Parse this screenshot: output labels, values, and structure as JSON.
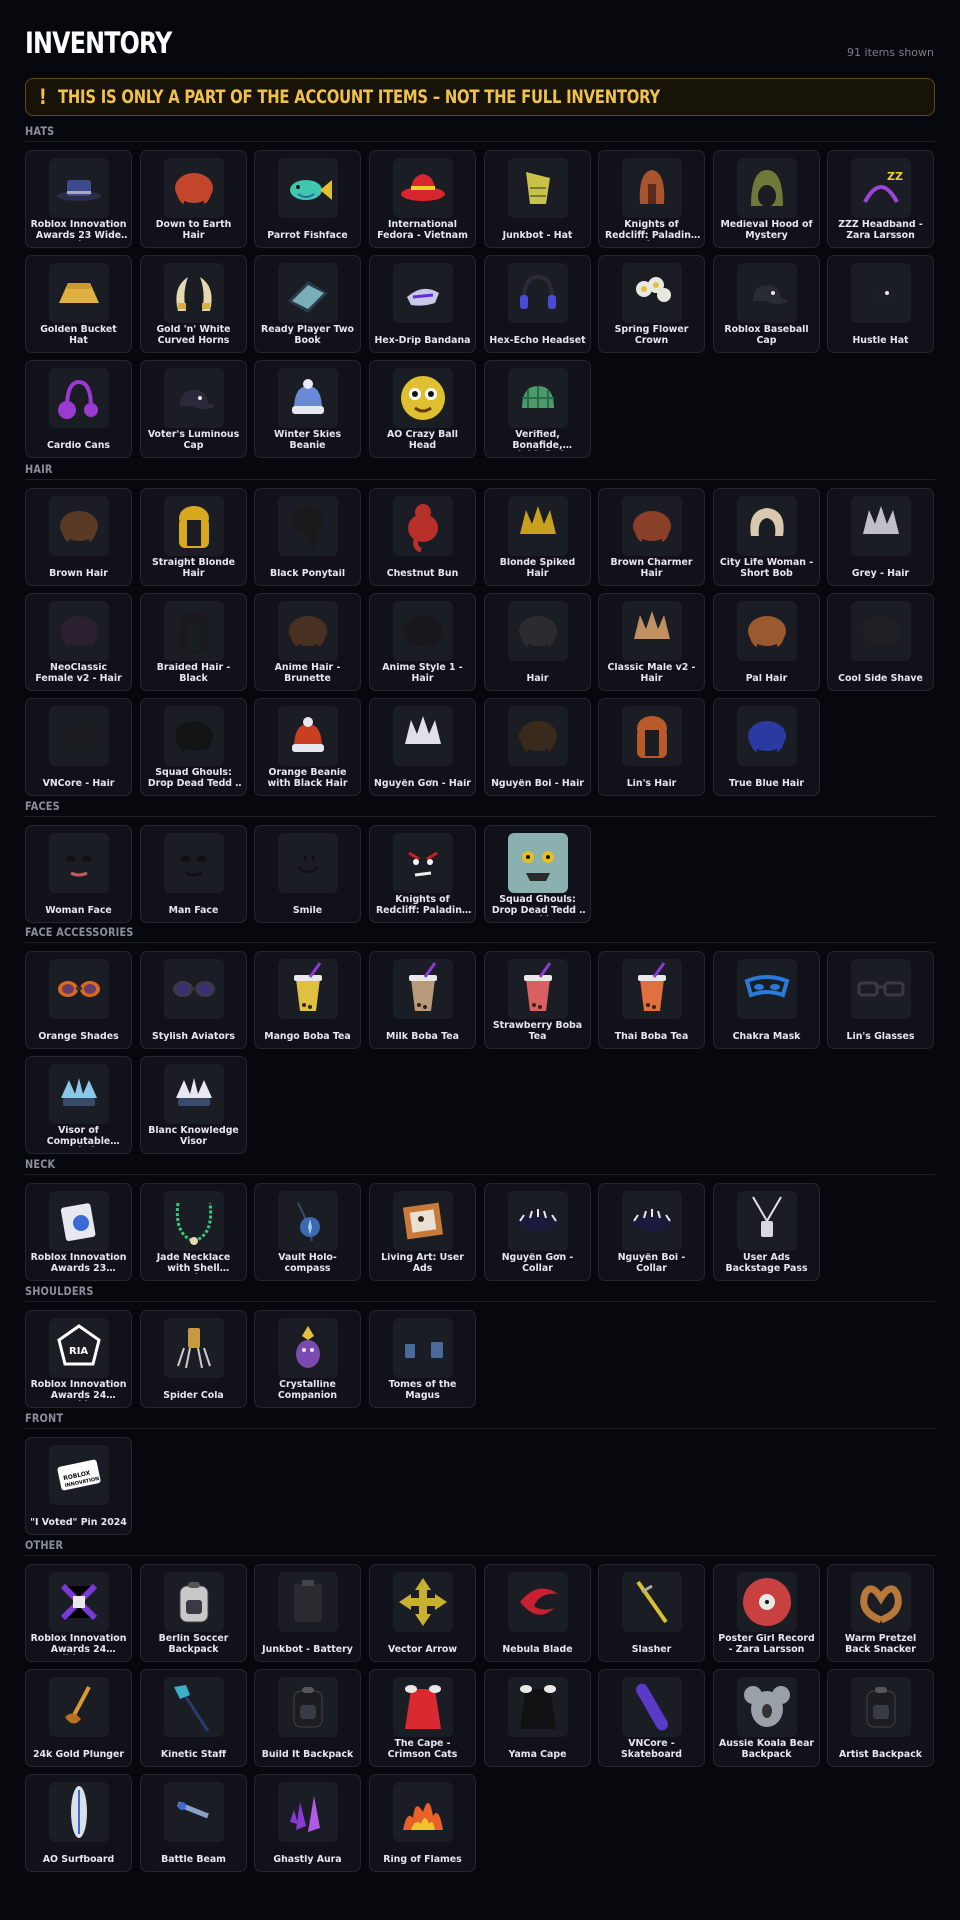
{
  "header": {
    "title": "INVENTORY",
    "count_text": "91 items shown"
  },
  "warning": {
    "icon": "!",
    "icon_name": "exclamation-icon",
    "text": "THIS IS ONLY A PART OF THE ACCOUNT ITEMS – NOT THE FULL INVENTORY",
    "color": "#f1c24a"
  },
  "sections": [
    {
      "label": "HATS",
      "items": [
        {
          "name": "Roblox Innovation Awards 23 Wide Bri…",
          "icon": "wide-brim-hat-icon",
          "color": "#3a4a8c"
        },
        {
          "name": "Down to Earth Hair",
          "icon": "hair-icon",
          "color": "#c2452c"
        },
        {
          "name": "Parrot Fishface",
          "icon": "fish-icon",
          "color": "#3ec8b0"
        },
        {
          "name": "International Fedora - Vietnam",
          "icon": "fedora-icon",
          "color": "#d8262e"
        },
        {
          "name": "Junkbot - Hat",
          "icon": "junk-hat-icon",
          "color": "#c8c24a"
        },
        {
          "name": "Knights of Redcliff: Paladin - Helmet",
          "icon": "helmet-icon",
          "color": "#a8542c"
        },
        {
          "name": "Medieval Hood of Mystery",
          "icon": "hood-icon",
          "color": "#6e7a3a"
        },
        {
          "name": "ZZZ Headband - Zara Larsson",
          "icon": "headband-icon",
          "color": "#9a44d8"
        },
        {
          "name": "Golden Bucket Hat",
          "icon": "bucket-hat-icon",
          "color": "#e0b040"
        },
        {
          "name": "Gold 'n' White Curved Horns",
          "icon": "horns-icon",
          "color": "#e3d8b0"
        },
        {
          "name": "Ready Player Two Book",
          "icon": "book-icon",
          "color": "#8ccad8"
        },
        {
          "name": "Hex-Drip Bandana",
          "icon": "bandana-icon",
          "color": "#c8c8e8"
        },
        {
          "name": "Hex-Echo Headset",
          "icon": "headset-icon",
          "color": "#4a4ad8"
        },
        {
          "name": "Spring Flower Crown",
          "icon": "flower-crown-icon",
          "color": "#e8e8e0"
        },
        {
          "name": "Roblox Baseball Cap",
          "icon": "cap-icon",
          "color": "#2a2c34"
        },
        {
          "name": "Hustle Hat",
          "icon": "cap-icon",
          "color": "#1c1e26"
        },
        {
          "name": "Cardio Cans",
          "icon": "earmuffs-icon",
          "color": "#9a3ad0"
        },
        {
          "name": "Voter's Luminous Cap",
          "icon": "cap-icon",
          "color": "#2a2a3a"
        },
        {
          "name": "Winter Skies Beanie",
          "icon": "beanie-icon",
          "color": "#6a8ad8"
        },
        {
          "name": "AO Crazy Ball Head",
          "icon": "ball-head-icon",
          "color": "#e0c030"
        },
        {
          "name": "Verified, Bonafide, Plaidafied",
          "icon": "plaid-cap-icon",
          "color": "#4a9a6a"
        }
      ]
    },
    {
      "label": "HAIR",
      "items": [
        {
          "name": "Brown Hair",
          "icon": "hair-icon",
          "color": "#5a3a24"
        },
        {
          "name": "Straight Blonde Hair",
          "icon": "long-hair-icon",
          "color": "#d8a820"
        },
        {
          "name": "Black Ponytail",
          "icon": "ponytail-icon",
          "color": "#1a1a1c"
        },
        {
          "name": "Chestnut Bun",
          "icon": "bun-icon",
          "color": "#b8302a"
        },
        {
          "name": "Blonde Spiked Hair",
          "icon": "spiked-hair-icon",
          "color": "#c8a020"
        },
        {
          "name": "Brown Charmer Hair",
          "icon": "hair-icon",
          "color": "#8a4028"
        },
        {
          "name": "City Life Woman - Short Bob",
          "icon": "bob-hair-icon",
          "color": "#d8c8b0"
        },
        {
          "name": "Grey - Hair",
          "icon": "spiked-hair-icon",
          "color": "#c0c0c8"
        },
        {
          "name": "NeoClassic Female v2 - Hair",
          "icon": "hair-icon",
          "color": "#2a2030"
        },
        {
          "name": "Braided Hair - Black",
          "icon": "long-hair-icon",
          "color": "#1a1a1e"
        },
        {
          "name": "Anime Hair - Brunette",
          "icon": "hair-icon",
          "color": "#4a3020"
        },
        {
          "name": "Anime Style 1 - Hair",
          "icon": "hair-icon",
          "color": "#18181c"
        },
        {
          "name": "Hair",
          "icon": "hair-icon",
          "color": "#2c2c30"
        },
        {
          "name": "Classic Male v2 - Hair",
          "icon": "spiked-hair-icon",
          "color": "#c09060"
        },
        {
          "name": "Pal Hair",
          "icon": "hair-icon",
          "color": "#9a5a30"
        },
        {
          "name": "Cool Side Shave",
          "icon": "hair-icon",
          "color": "#202024"
        },
        {
          "name": "VNCore - Hair",
          "icon": "hair-icon",
          "color": "#1c1c20"
        },
        {
          "name": "Squad Ghouls: Drop Dead Tedd - …",
          "icon": "hair-icon",
          "color": "#141416"
        },
        {
          "name": "Orange Beanie with Black Hair",
          "icon": "beanie-icon",
          "color": "#c84020"
        },
        {
          "name": "Nguyễn Gơn - Hair",
          "icon": "spiked-hair-icon",
          "color": "#e0e0e8"
        },
        {
          "name": "Nguyễn Boi - Hair",
          "icon": "hair-icon",
          "color": "#3a2a1c"
        },
        {
          "name": "Lin's Hair",
          "icon": "long-hair-icon",
          "color": "#b85a2a"
        },
        {
          "name": "True Blue Hair",
          "icon": "hair-icon",
          "color": "#2a3aa0"
        }
      ]
    },
    {
      "label": "FACES",
      "items": [
        {
          "name": "Woman Face",
          "icon": "face-icon",
          "color": "#c85a5a"
        },
        {
          "name": "Man Face",
          "icon": "face-icon",
          "color": "#111111"
        },
        {
          "name": "Smile",
          "icon": "smile-icon",
          "color": "#111111"
        },
        {
          "name": "Knights of Redcliff: Paladin - Face",
          "icon": "angry-face-icon",
          "color": "#c82020"
        },
        {
          "name": "Squad Ghouls: Drop Dead Tedd - Zombi…",
          "icon": "zombie-face-icon",
          "color": "#8ab0b0"
        }
      ]
    },
    {
      "label": "FACE ACCESSORIES",
      "items": [
        {
          "name": "Orange Shades",
          "icon": "sunglasses-icon",
          "color": "#d86a20"
        },
        {
          "name": "Stylish Aviators",
          "icon": "sunglasses-icon",
          "color": "#3a3a4a"
        },
        {
          "name": "Mango Boba Tea",
          "icon": "boba-tea-icon",
          "color": "#e0c040"
        },
        {
          "name": "Milk Boba Tea",
          "icon": "boba-tea-icon",
          "color": "#b89a7a"
        },
        {
          "name": "Strawberry Boba Tea",
          "icon": "boba-tea-icon",
          "color": "#d86060"
        },
        {
          "name": "Thai Boba Tea",
          "icon": "boba-tea-icon",
          "color": "#e07040"
        },
        {
          "name": "Chakra Mask",
          "icon": "mask-icon",
          "color": "#2a7ad8"
        },
        {
          "name": "Lin's Glasses",
          "icon": "glasses-icon",
          "color": "#2a2a30"
        },
        {
          "name": "Visor of Computable Knowledge",
          "icon": "visor-icon",
          "color": "#8ac8e8"
        },
        {
          "name": "Blanc Knowledge Visor",
          "icon": "visor-icon",
          "color": "#e8e8f0"
        }
      ]
    },
    {
      "label": "NECK",
      "items": [
        {
          "name": "Roblox Innovation Awards 23 Memory…",
          "icon": "card-icon",
          "color": "#3a6ad8"
        },
        {
          "name": "Jade Necklace with Shell Pendant",
          "icon": "necklace-icon",
          "color": "#3ac880"
        },
        {
          "name": "Vault Holo-compass",
          "icon": "compass-icon",
          "color": "#3a6ab0"
        },
        {
          "name": "Living Art: User Ads",
          "icon": "frame-icon",
          "color": "#c87a3a"
        },
        {
          "name": "Nguyễn Gơn - Collar",
          "icon": "collar-icon",
          "color": "#1a1a3a"
        },
        {
          "name": "Nguyễn Boi - Collar",
          "icon": "collar-icon",
          "color": "#1a1a3a"
        },
        {
          "name": "User Ads Backstage Pass",
          "icon": "lanyard-icon",
          "color": "#e0e0e8"
        }
      ]
    },
    {
      "label": "SHOULDERS",
      "items": [
        {
          "name": "Roblox Innovation Awards 24 Sparkle…",
          "icon": "award-icon",
          "color": "#ffffff"
        },
        {
          "name": "Spider Cola",
          "icon": "spider-icon",
          "color": "#c89a40"
        },
        {
          "name": "Crystalline Companion",
          "icon": "companion-icon",
          "color": "#7a4ab0"
        },
        {
          "name": "Tomes of the Magus",
          "icon": "tomes-icon",
          "color": "#4a6a9a"
        }
      ]
    },
    {
      "label": "FRONT",
      "items": [
        {
          "name": "\"I Voted\" Pin 2024",
          "icon": "pin-icon",
          "color": "#e8e8e8"
        }
      ]
    },
    {
      "label": "OTHER",
      "items": [
        {
          "name": "Roblox Innovation Awards 24 Ribbon…",
          "icon": "ribbon-icon",
          "color": "#7a3ad8"
        },
        {
          "name": "Berlin Soccer Backpack",
          "icon": "backpack-icon",
          "color": "#c8c8c8"
        },
        {
          "name": "Junkbot - Battery",
          "icon": "battery-icon",
          "color": "#2a2a30"
        },
        {
          "name": "Vector Arrow",
          "icon": "arrow-icon",
          "color": "#c8b030"
        },
        {
          "name": "Nebula Blade",
          "icon": "blade-icon",
          "color": "#c82030"
        },
        {
          "name": "Slasher",
          "icon": "sword-icon",
          "color": "#d8c030"
        },
        {
          "name": "Poster Girl Record - Zara Larsson",
          "icon": "record-icon",
          "color": "#c84040"
        },
        {
          "name": "Warm Pretzel Back Snacker",
          "icon": "pretzel-icon",
          "color": "#b8783a"
        },
        {
          "name": "24k Gold Plunger",
          "icon": "plunger-icon",
          "color": "#d89a30"
        },
        {
          "name": "Kinetic Staff",
          "icon": "staff-icon",
          "color": "#3ab0c8"
        },
        {
          "name": "Build It Backpack",
          "icon": "backpack-icon",
          "color": "#1c1c22"
        },
        {
          "name": "The Cape - Crimson Cats",
          "icon": "cape-icon",
          "color": "#d82a30"
        },
        {
          "name": "Yama Cape",
          "icon": "cape-icon",
          "color": "#111114"
        },
        {
          "name": "VNCore - Skateboard",
          "icon": "skateboard-icon",
          "color": "#5a3ac8"
        },
        {
          "name": "Aussie Koala Bear Backpack",
          "icon": "koala-icon",
          "color": "#9aa0a8"
        },
        {
          "name": "Artist Backpack",
          "icon": "backpack-icon",
          "color": "#1c1c22"
        },
        {
          "name": "AO Surfboard",
          "icon": "surfboard-icon",
          "color": "#d8e0e8"
        },
        {
          "name": "Battle Beam",
          "icon": "beam-icon",
          "color": "#8aa0c8"
        },
        {
          "name": "Ghastly Aura",
          "icon": "aura-icon",
          "color": "#8a3ad8"
        },
        {
          "name": "Ring of Flames",
          "icon": "flames-icon",
          "color": "#e8602a"
        }
      ]
    }
  ]
}
